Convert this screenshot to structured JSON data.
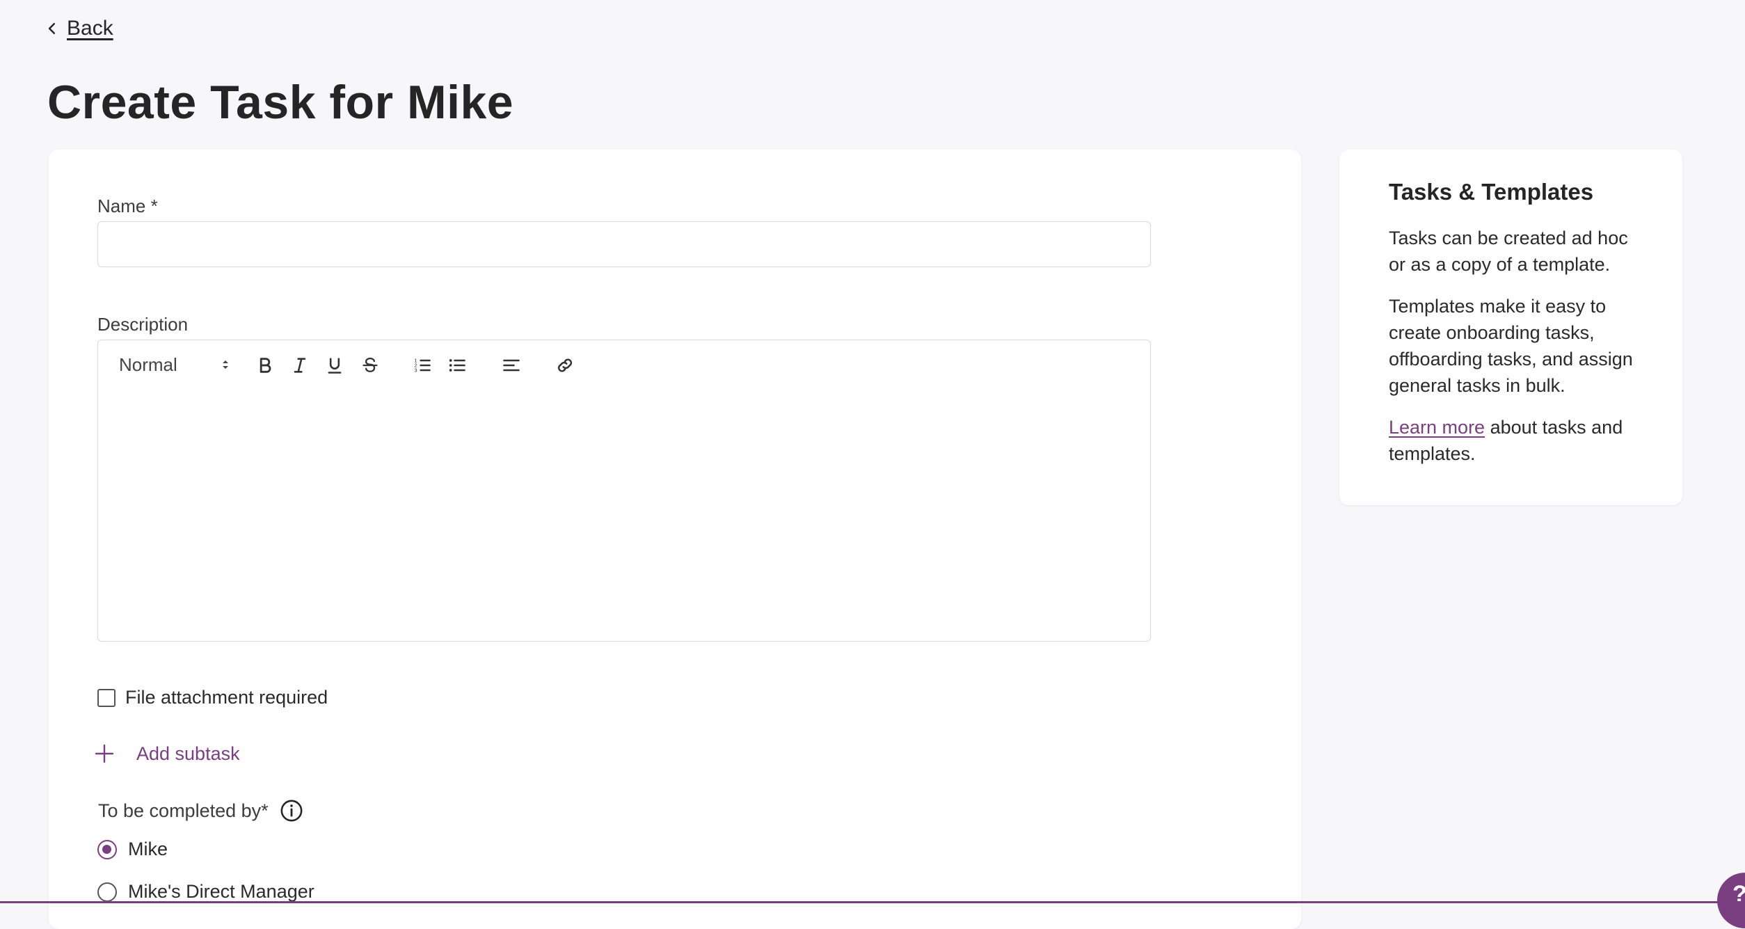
{
  "nav": {
    "back_label": "Back"
  },
  "page": {
    "title": "Create Task for Mike"
  },
  "form": {
    "name_label": "Name *",
    "name_value": "",
    "description_label": "Description",
    "editor": {
      "format_value": "Normal",
      "tools": [
        "bold",
        "italic",
        "underline",
        "strikethrough",
        "ordered-list",
        "bullet-list",
        "align",
        "link"
      ]
    },
    "file_attachment_label": "File attachment required",
    "file_attachment_checked": false,
    "add_subtask_label": "Add subtask",
    "completed_by_label": "To be completed by*",
    "assignee_options": [
      {
        "label": "Mike",
        "selected": true
      },
      {
        "label": "Mike's Direct Manager",
        "selected": false
      }
    ]
  },
  "sidebar": {
    "title": "Tasks & Templates",
    "p1": "Tasks can be created ad hoc or as a copy of a template.",
    "p2": "Templates make it easy to create onboarding tasks, offboarding tasks, and assign general tasks in bulk.",
    "learn_more_link": "Learn more",
    "learn_more_suffix": " about tasks and templates."
  },
  "help": {
    "glyph": "?"
  },
  "colors": {
    "accent": "#7a3f80",
    "background": "#f7f7fa",
    "card": "#ffffff",
    "text": "#252525"
  }
}
